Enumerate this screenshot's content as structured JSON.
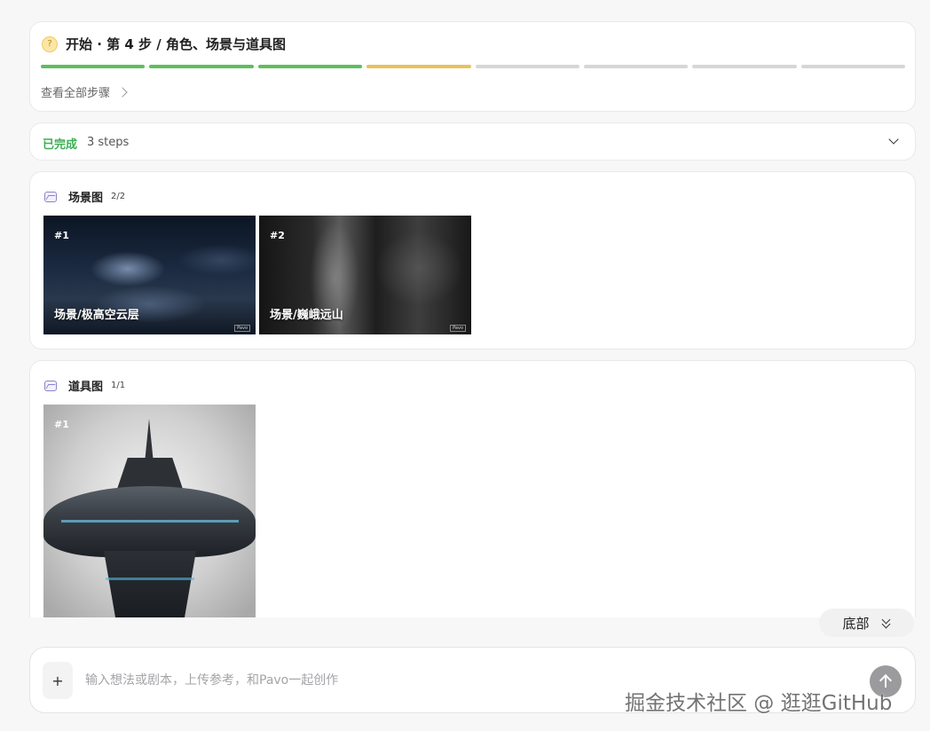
{
  "step": {
    "title": "开始 · 第 4 步 / 角色、场景与道具图",
    "view_all": "查看全部步骤",
    "progress_colors": [
      "#5cbf5c",
      "#5cbf5c",
      "#5cbf5c",
      "#e6c35a",
      "#d6d6d6",
      "#d6d6d6",
      "#d6d6d6",
      "#d6d6d6"
    ]
  },
  "done": {
    "status": "已完成",
    "count": "3 steps"
  },
  "scene_section": {
    "title": "场景图",
    "count": "2/2",
    "items": [
      {
        "num": "#1",
        "caption": "场景/极高空云层",
        "watermark": "Pavo"
      },
      {
        "num": "#2",
        "caption": "场景/巍峨远山",
        "watermark": "Pavo"
      }
    ]
  },
  "prop_section": {
    "title": "道具图",
    "count": "1/1",
    "items": [
      {
        "num": "#1"
      }
    ]
  },
  "bottom_button": "底部",
  "composer": {
    "add_label": "+",
    "placeholder": "输入想法或剧本，上传参考，和Pavo一起创作"
  },
  "watermark": "掘金技术社区 @ 逛逛GitHub"
}
